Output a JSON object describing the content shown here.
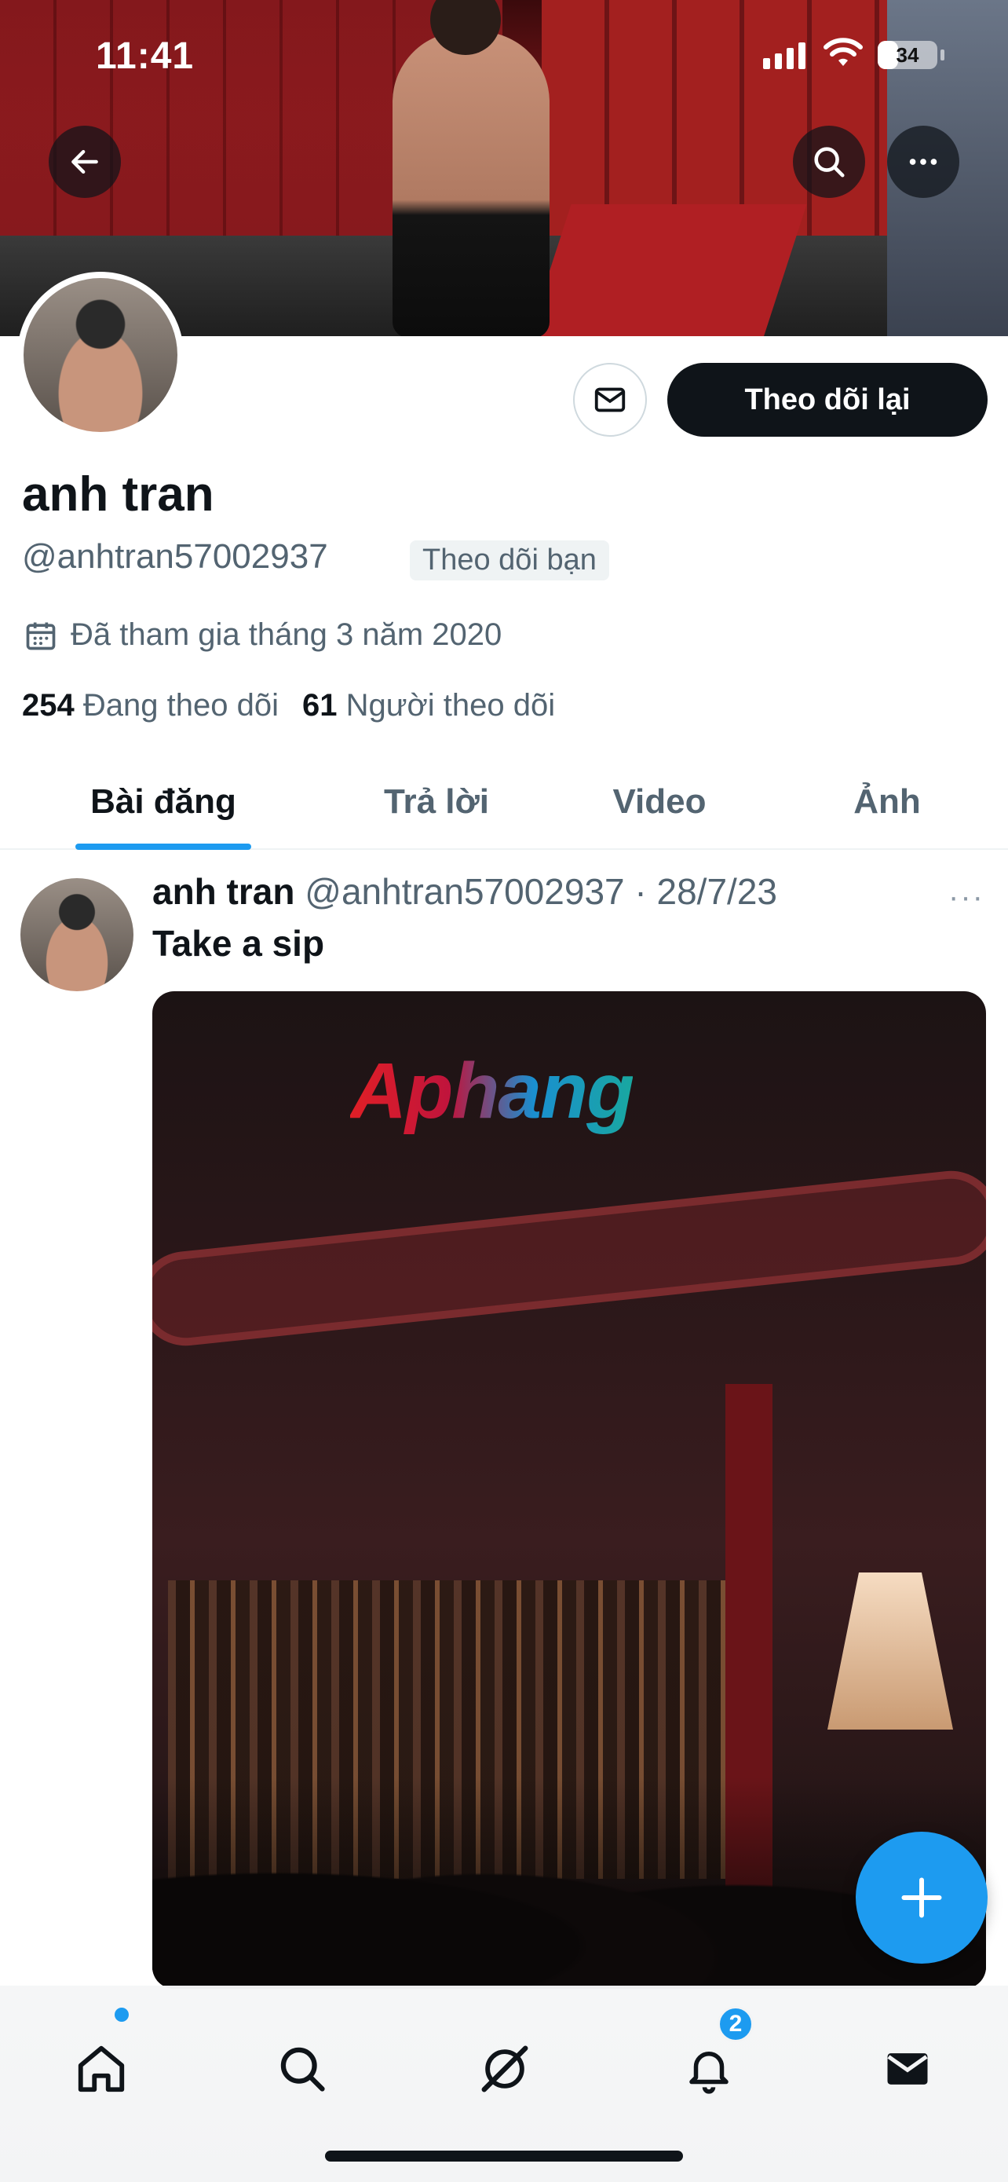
{
  "status_bar": {
    "time": "11:41",
    "battery": "34",
    "battery_level": 0.34
  },
  "header": {
    "back_icon": "arrow-left-icon",
    "search_icon": "search-icon",
    "more_icon": "more-horizontal-icon"
  },
  "profile": {
    "display_name": "anh tran",
    "handle": "@anhtran57002937",
    "follows_you_badge": "Theo dõi bạn",
    "joined": "Đã tham gia tháng 3 năm 2020",
    "following_count": "254",
    "following_label": "Đang theo dõi",
    "followers_count": "61",
    "followers_label": "Người theo dõi",
    "follow_button": "Theo dõi lại"
  },
  "tabs": [
    {
      "label": "Bài đăng",
      "active": true
    },
    {
      "label": "Trả lời",
      "active": false
    },
    {
      "label": "Video",
      "active": false
    },
    {
      "label": "Ảnh",
      "active": false
    }
  ],
  "post": {
    "name": "anh tran",
    "meta": "@anhtran57002937 · 28/7/23",
    "text": "Take a sip",
    "more": "···",
    "watermark": "Aphang"
  },
  "bottom_nav": {
    "items": [
      "home-icon",
      "search-icon",
      "grok-icon",
      "notifications-icon",
      "messages-icon"
    ],
    "notification_badge": "2"
  },
  "colors": {
    "accent": "#1d9bf0",
    "text": "#0f1419",
    "secondary": "#536471"
  }
}
